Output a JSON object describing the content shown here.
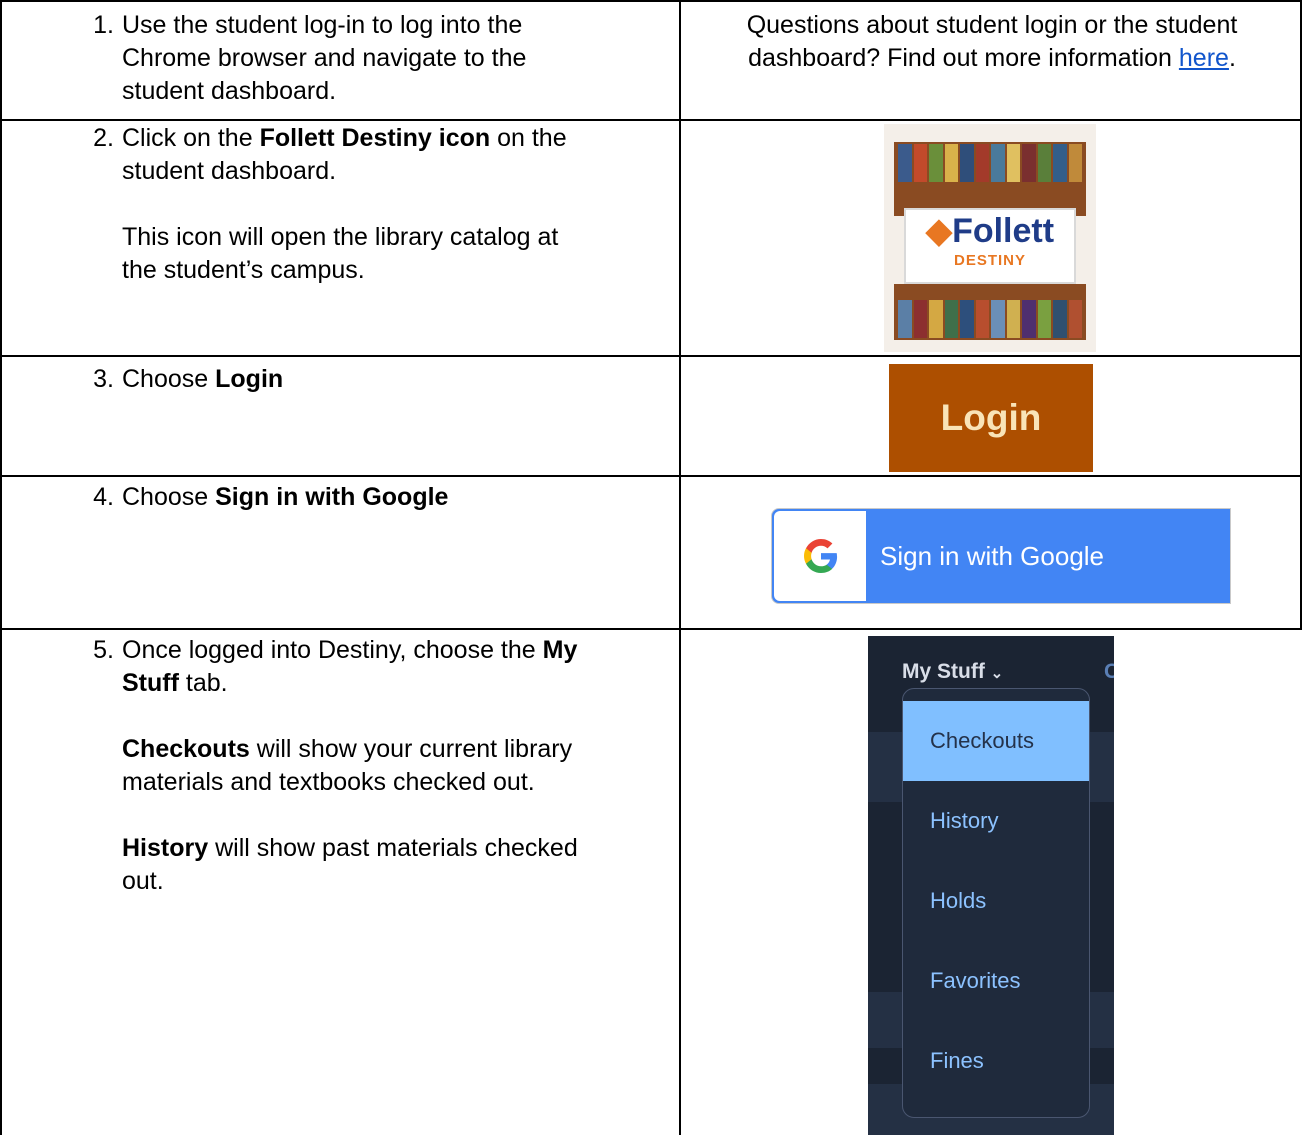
{
  "rows": [
    {
      "number": "1.",
      "lines": [
        [
          {
            "t": "Use the student log-in to log into the"
          }
        ],
        [
          {
            "t": "Chrome browser and navigate to the"
          }
        ],
        [
          {
            "t": "student dashboard."
          }
        ]
      ],
      "right": {
        "line1": "Questions about student login or the student",
        "line2_pre": "dashboard?  Find out more information ",
        "link": "here",
        "line2_post": "."
      }
    },
    {
      "number": "2.",
      "lines": [
        [
          {
            "t": "Click on the "
          },
          {
            "t": "Follett Destiny icon",
            "b": true
          },
          {
            "t": " on the"
          }
        ],
        [
          {
            "t": "student dashboard."
          }
        ],
        [],
        [
          {
            "t": "This icon will open the library catalog at"
          }
        ],
        [
          {
            "t": "the student’s campus."
          }
        ]
      ],
      "image": {
        "title": "Follett",
        "subtitle": "DESTINY"
      }
    },
    {
      "number": "3.",
      "lines": [
        [
          {
            "t": "Choose "
          },
          {
            "t": "Login",
            "b": true
          }
        ]
      ],
      "button": "Login"
    },
    {
      "number": "4.",
      "lines": [
        [
          {
            "t": "Choose "
          },
          {
            "t": "Sign in with Google",
            "b": true
          }
        ]
      ],
      "button": "Sign in with Google"
    },
    {
      "number": "5.",
      "lines": [
        [
          {
            "t": "Once logged into Destiny, choose the "
          },
          {
            "t": "My",
            "b": true
          }
        ],
        [
          {
            "t": "Stuff",
            "b": true
          },
          {
            "t": " tab."
          }
        ],
        [],
        [
          {
            "t": "Checkouts",
            "b": true
          },
          {
            "t": " will show your current library"
          }
        ],
        [
          {
            "t": "materials and textbooks checked out."
          }
        ],
        [],
        [
          {
            "t": "History",
            "b": true
          },
          {
            "t": " will show past materials checked"
          }
        ],
        [
          {
            "t": "out."
          }
        ]
      ],
      "menu": {
        "header": "My Stuff",
        "next_tab_letter": "C",
        "items": [
          "Checkouts",
          "History",
          "Holds",
          "Favorites",
          "Fines"
        ],
        "active": "Checkouts"
      }
    }
  ],
  "colors": {
    "link": "#1155cc",
    "login_bg": "#ad4f00",
    "google_blue": "#4285f4",
    "menu_active": "#80bfff"
  },
  "icons": [
    "google-g-icon",
    "chevron-down-icon"
  ]
}
